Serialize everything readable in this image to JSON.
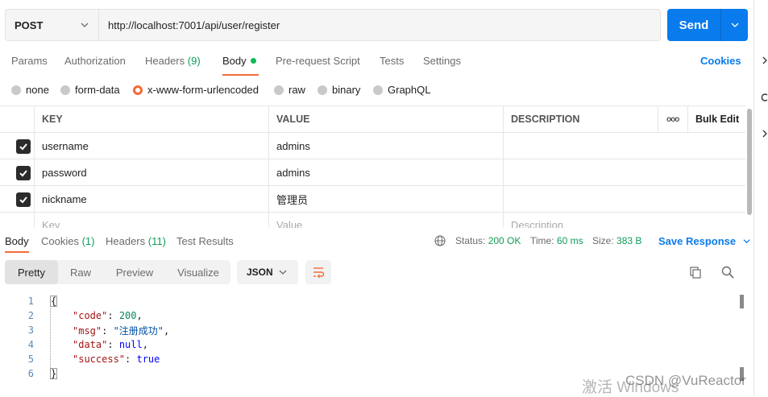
{
  "request": {
    "method": "POST",
    "url": "http://localhost:7001/api/user/register",
    "send_label": "Send"
  },
  "request_tabs": {
    "params": "Params",
    "authorization": "Authorization",
    "headers": "Headers",
    "headers_count": "(9)",
    "body": "Body",
    "prerequest": "Pre-request Script",
    "tests": "Tests",
    "settings": "Settings",
    "cookies": "Cookies"
  },
  "body_types": {
    "none": "none",
    "form_data": "form-data",
    "urlencoded": "x-www-form-urlencoded",
    "raw": "raw",
    "binary": "binary",
    "graphql": "GraphQL",
    "selected": "x-www-form-urlencoded"
  },
  "params_table": {
    "headers": {
      "key": "KEY",
      "value": "VALUE",
      "description": "DESCRIPTION",
      "more": "ooo",
      "bulk_edit": "Bulk Edit"
    },
    "rows": [
      {
        "checked": true,
        "key": "username",
        "value": "admins",
        "description": ""
      },
      {
        "checked": true,
        "key": "password",
        "value": "admins",
        "description": ""
      },
      {
        "checked": true,
        "key": "nickname",
        "value": "管理员",
        "description": ""
      }
    ],
    "placeholders": {
      "key": "Key",
      "value": "Value",
      "description": "Description"
    }
  },
  "response_tabs": {
    "body": "Body",
    "cookies": "Cookies",
    "cookies_count": "(1)",
    "headers": "Headers",
    "headers_count": "(11)",
    "test_results": "Test Results"
  },
  "response_status": {
    "status_label": "Status:",
    "status_value": "200 OK",
    "time_label": "Time:",
    "time_value": "60 ms",
    "size_label": "Size:",
    "size_value": "383 B",
    "save_response": "Save Response"
  },
  "view_modes": {
    "pretty": "Pretty",
    "raw": "Raw",
    "preview": "Preview",
    "visualize": "Visualize",
    "format": "JSON"
  },
  "response_body": {
    "line_numbers": [
      "1",
      "2",
      "3",
      "4",
      "5",
      "6"
    ],
    "open_brace": "{",
    "close_brace": "}",
    "fields": [
      {
        "key": "\"code\"",
        "value": "200",
        "kind": "number",
        "comma": ","
      },
      {
        "key": "\"msg\"",
        "value": "\"注册成功\"",
        "kind": "string",
        "comma": ","
      },
      {
        "key": "\"data\"",
        "value": "null",
        "kind": "keyword",
        "comma": ","
      },
      {
        "key": "\"success\"",
        "value": "true",
        "kind": "keyword",
        "comma": ""
      }
    ]
  },
  "watermark": {
    "activate": "激活 Windows",
    "csdn": "CSDN @VuReactor"
  },
  "colors": {
    "accent_orange": "#f26b3a",
    "send_blue": "#097bed",
    "status_green": "#0f9d58"
  }
}
